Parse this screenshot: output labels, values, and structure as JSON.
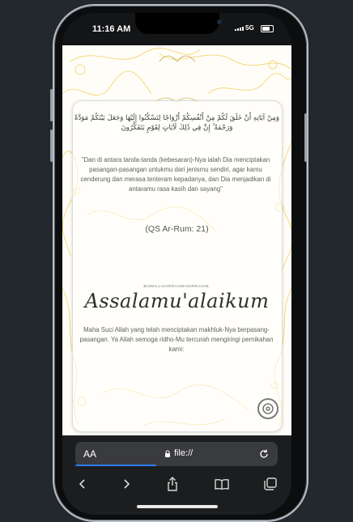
{
  "status": {
    "time": "11:16 AM",
    "network": "5G",
    "battery_level": 0.75
  },
  "verse": {
    "arabic": "وَمِنْ آيَاتِهِ أَنْ خَلَقَ لَكُمْ مِنْ أَنْفُسِكُمْ أَزْوَاجًا لِتَسْكُنُوا إِلَيْهَا وَجَعَلَ بَيْنَكُمْ مَوَدَّةً وَرَحْمَةً ۚ إِنَّ فِي ذَٰلِكَ لَآيَاتٍ لِقَوْمٍ يَتَفَكَّرُونَ",
    "translation": "\"Dan di antara tanda-tanda (kebesaran)-Nya ialah Dia menciptakan pasangan-pasangan untukmu dari jenismu sendiri, agar kamu cenderung dan merasa tenteram kepadanya, dan Dia menjadikan di antaramu rasa kasih dan sayang\"",
    "reference": "(QS Ar-Rum: 21)"
  },
  "greeting": {
    "bismillah": "BISMILLAHIRRAHMANIRRAHIM,",
    "salam": "Assalamu'alaikum",
    "intro": "Maha Suci Allah yang telah menciptakan makhluk-Nya berpasang-pasangan. Ya Allah semoga ridho-Mu tercurah mengiringi pernikahan kami:"
  },
  "safari": {
    "text_size_label": "AA",
    "url": "file://",
    "load_progress": 0.4
  },
  "icons": {
    "music": "music-disc-icon",
    "back": "chevron-left-icon",
    "forward": "chevron-right-icon",
    "share": "share-icon",
    "bookmarks": "book-icon",
    "tabs": "tabs-icon",
    "lock": "lock-icon",
    "reload": "reload-icon"
  },
  "colors": {
    "ornament": "#f0c94a",
    "phone_bezel": "#0c0d0f",
    "safari_bar": "#1c1d1f",
    "accent": "#2f7cf6"
  }
}
